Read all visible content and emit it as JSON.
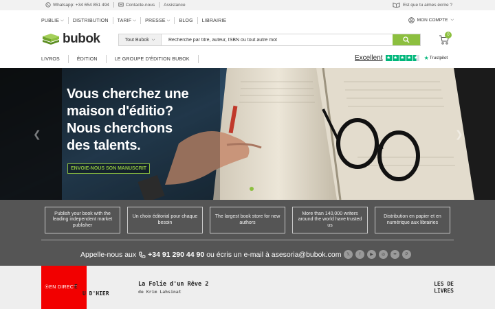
{
  "topbar": {
    "whatsapp": "Whatsapp: +34 654 851 494",
    "contact": "Contacte-nous",
    "assistance": "Assistance",
    "write_prompt": "Est que tu aimes écrire ?"
  },
  "mainnav": {
    "items": [
      "PUBLIE",
      "DISTRIBUTION",
      "TARIF",
      "PRESSE",
      "BLOG",
      "LIBRAIRIE"
    ],
    "account": "MON COMPTE"
  },
  "logo": {
    "text": "bubok"
  },
  "search": {
    "scope": "Tout Bubok",
    "placeholder": "Recherche par titre, auteur, ISBN ou tout autre mot"
  },
  "cart": {
    "count": "0"
  },
  "subnav": {
    "items": [
      "LIVROS",
      "ÉDITION",
      "LE GROUPE D'ÉDITION BUBOK"
    ]
  },
  "trustpilot": {
    "rating_label": "Excellent",
    "brand": "Trustpilot",
    "stars": 4.5
  },
  "hero": {
    "line1": "Vous cherchez une",
    "line2": "maison d'éditio?",
    "line3": "Nous cherchons",
    "line4": "des talents.",
    "cta": "ENVOIE-NOUS SON MANUSCRIT"
  },
  "features": [
    "Publish your book with the leading independent market publisher",
    "Un choix éditorial pour chaque besoin",
    "The largest book store for new authors",
    "More than 140,000 writers around the world have trusted us",
    "Distribution en papier et en numérique aux librairies"
  ],
  "contact": {
    "prefix": "Appelle-nous aux",
    "phone": "+34 91 290 44 90",
    "suffix": "ou écris un e-mail à asesoria@bubok.com"
  },
  "socials": [
    "x",
    "facebook",
    "youtube",
    "instagram",
    "flickr",
    "pinterest"
  ],
  "bottom": {
    "live": "EN DIRECT",
    "yesterday_a": "E",
    "yesterday_b": "U D'HIER",
    "book_title": "La Folie d'un Rêve 2",
    "book_author": "de Krim Lahsinat",
    "les": "LES DE",
    "livres": "LIVRES"
  },
  "colors": {
    "accent": "#8cbf3f",
    "trustpilot": "#00b67a",
    "live": "#f20000",
    "features_bg": "#555555"
  }
}
